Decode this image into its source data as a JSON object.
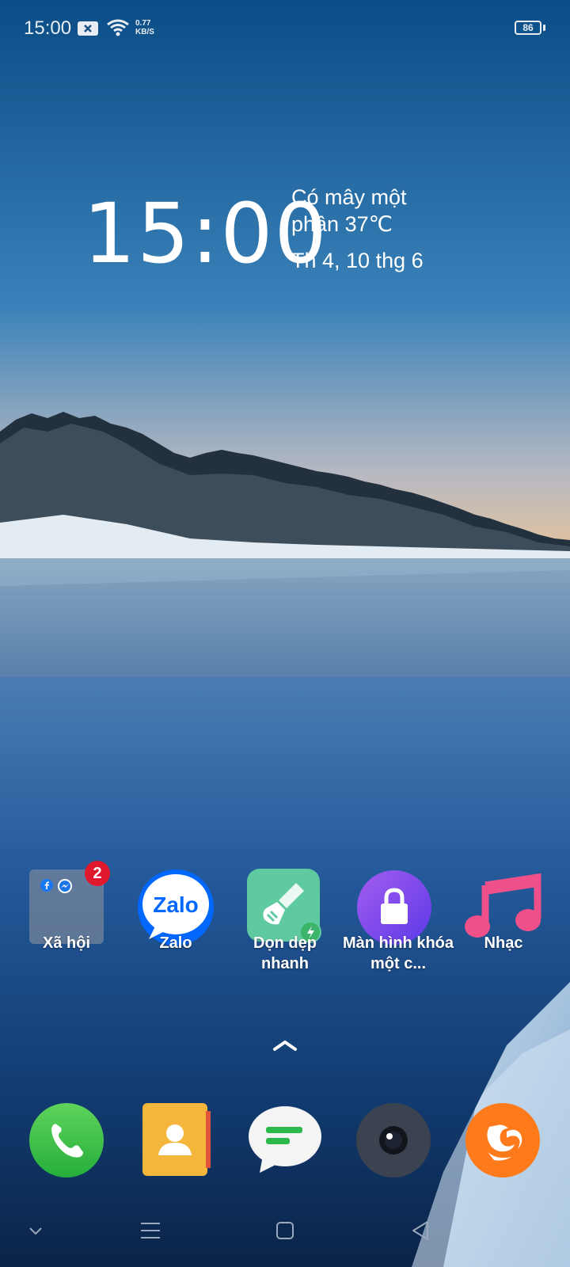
{
  "status_bar": {
    "time": "15:00",
    "net_speed_value": "0.77",
    "net_speed_unit": "KB/S",
    "battery": "86"
  },
  "clock_widget": {
    "time": "15:00",
    "weather": "Có mây một phần 37℃",
    "date": "Th 4, 10 thg 6"
  },
  "apps": [
    {
      "label": "Xã hội",
      "badge": "2",
      "icon": "folder-icon"
    },
    {
      "label": "Zalo",
      "icon": "zalo-icon",
      "icon_text": "Zalo"
    },
    {
      "label": "Dọn dẹp nhanh",
      "icon": "broom-icon"
    },
    {
      "label": "Màn hình khóa một c...",
      "icon": "lock-icon"
    },
    {
      "label": "Nhạc",
      "icon": "music-note-icon"
    }
  ],
  "dock": [
    {
      "icon": "phone-icon"
    },
    {
      "icon": "contacts-icon"
    },
    {
      "icon": "messages-icon"
    },
    {
      "icon": "camera-icon"
    },
    {
      "icon": "uc-browser-icon"
    }
  ],
  "nav_bar": [
    {
      "icon": "chevron-down-icon"
    },
    {
      "icon": "menu-icon"
    },
    {
      "icon": "home-icon"
    },
    {
      "icon": "back-icon"
    }
  ],
  "colors": {
    "badge": "#e0182d",
    "zalo_blue": "#0068ff",
    "cleaner_green": "#5fc9a0",
    "lock_purple": "#7b4ff0",
    "music_pink": "#f0508a",
    "phone_green": "#3cc346",
    "contacts_orange": "#f5b73b",
    "uc_orange": "#ff7a1a"
  }
}
